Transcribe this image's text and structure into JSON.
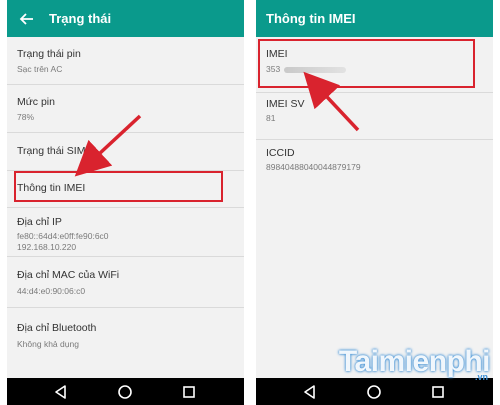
{
  "left": {
    "title": "Trạng thái",
    "items": [
      {
        "label": "Trạng thái pin",
        "value": "Sạc trên AC"
      },
      {
        "label": "Mức pin",
        "value": "78%"
      },
      {
        "label": "Trạng thái SIM",
        "value": ""
      },
      {
        "label": "Thông tin IMEI",
        "value": ""
      },
      {
        "label": "Địa chỉ IP",
        "value": "fe80::64d4:e0ff:fe90:6c0",
        "value2": "192.168.10.220"
      },
      {
        "label": "Địa chỉ MAC của WiFi",
        "value": "44:d4:e0:90:06:c0"
      },
      {
        "label": "Địa chỉ Bluetooth",
        "value": "Không khả dụng"
      }
    ]
  },
  "right": {
    "title": "Thông tin IMEI",
    "items": [
      {
        "label": "IMEI",
        "value": "353"
      },
      {
        "label": "IMEI SV",
        "value": "81"
      },
      {
        "label": "ICCID",
        "value": "89840488040044879179"
      }
    ]
  },
  "watermark": {
    "main": "Taimienphi",
    "sub": ".vn"
  },
  "colors": {
    "appbar": "#0a9a8c",
    "highlight": "#d9232e",
    "background": "#f2f2f2"
  },
  "icons": {
    "back": "arrow-left-icon",
    "nav": [
      "back-triangle-icon",
      "home-circle-icon",
      "recents-square-icon"
    ]
  }
}
